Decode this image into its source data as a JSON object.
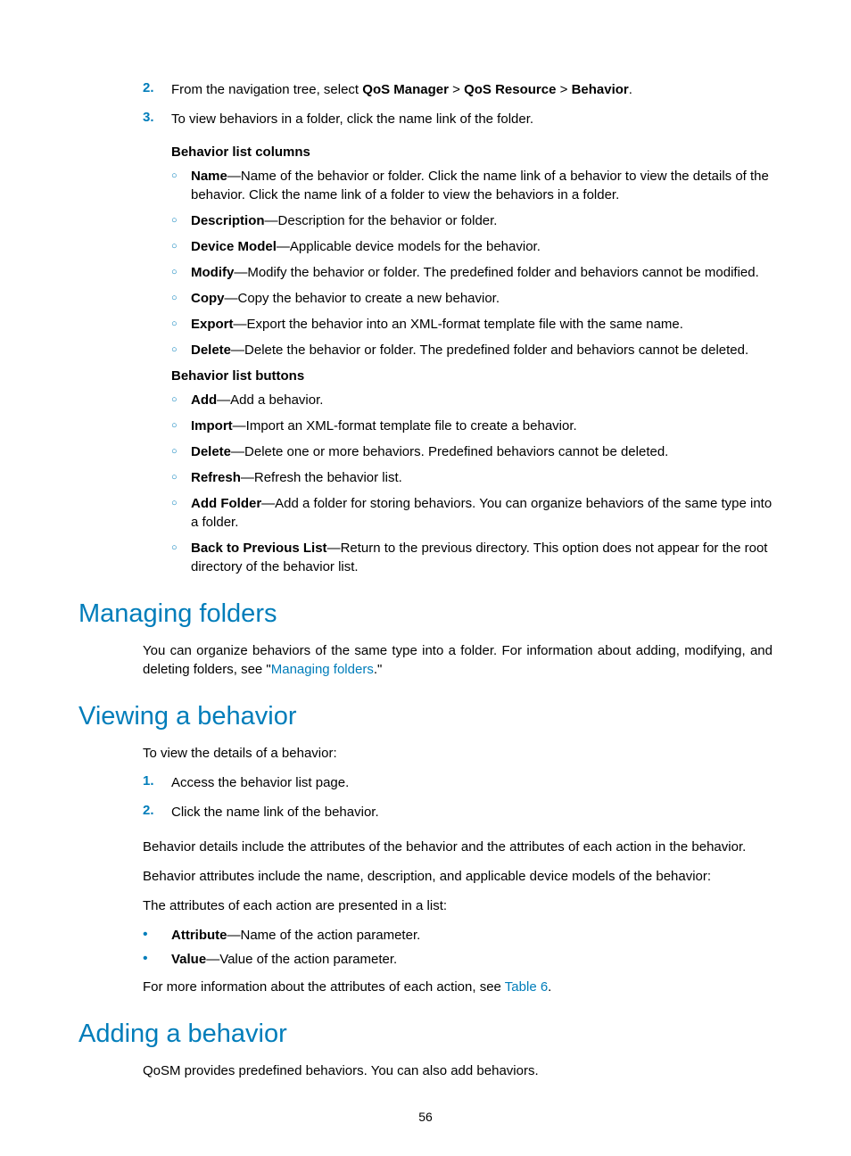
{
  "steps": {
    "s2": {
      "num": "2.",
      "pre": "From the navigation tree, select ",
      "b1": "QoS Manager",
      "sep1": " > ",
      "b2": "QoS Resource",
      "sep2": " > ",
      "b3": "Behavior",
      "post": "."
    },
    "s3": {
      "num": "3.",
      "text": "To view behaviors in a folder, click the name link of the folder."
    }
  },
  "cols_heading": "Behavior list columns",
  "cols": [
    {
      "term": "Name",
      "desc": "—Name of the behavior or folder. Click the name link of a behavior to view the details of the behavior. Click the name link of a folder to view the behaviors in a folder."
    },
    {
      "term": "Description",
      "desc": "—Description for the behavior or folder."
    },
    {
      "term": "Device Model",
      "desc": "—Applicable device models for the behavior."
    },
    {
      "term": "Modify",
      "desc": "—Modify the behavior or folder. The predefined folder and behaviors cannot be modified."
    },
    {
      "term": "Copy",
      "desc": "—Copy the behavior to create a new behavior."
    },
    {
      "term": "Export",
      "desc": "—Export the behavior into an XML-format template file with the same name."
    },
    {
      "term": "Delete",
      "desc": "—Delete the behavior or folder. The predefined folder and behaviors cannot be deleted."
    }
  ],
  "btns_heading": "Behavior list buttons",
  "btns": [
    {
      "term": "Add",
      "desc": "—Add a behavior."
    },
    {
      "term": "Import",
      "desc": "—Import an XML-format template file to create a behavior."
    },
    {
      "term": "Delete",
      "desc": "—Delete one or more behaviors. Predefined behaviors cannot be deleted."
    },
    {
      "term": "Refresh",
      "desc": "—Refresh the behavior list."
    },
    {
      "term": "Add Folder",
      "desc": "—Add a folder for storing behaviors. You can organize behaviors of the same type into a folder."
    },
    {
      "term": "Back to Previous List",
      "desc": "—Return to the previous directory. This option does not appear for the root directory of the behavior list."
    }
  ],
  "managing": {
    "heading": "Managing folders",
    "p_pre": "You can organize behaviors of the same type into a folder. For information about adding, modifying, and deleting folders, see \"",
    "link": "Managing folders",
    "p_post": ".\""
  },
  "viewing": {
    "heading": "Viewing a behavior",
    "intro": "To view the details of a behavior:",
    "s1": {
      "num": "1.",
      "text": "Access the behavior list page."
    },
    "s2": {
      "num": "2.",
      "text": "Click the name link of the behavior."
    },
    "p1": "Behavior details include the attributes of the behavior and the attributes of each action in the behavior.",
    "p2": "Behavior attributes include the name, description, and applicable device models of the behavior:",
    "p3": "The attributes of each action are presented in a list:",
    "attrs": [
      {
        "term": "Attribute",
        "desc": "—Name of the action parameter."
      },
      {
        "term": "Value",
        "desc": "—Value of the action parameter."
      }
    ],
    "more_pre": "For more information about the attributes of each action, see ",
    "more_link": "Table 6",
    "more_post": "."
  },
  "adding": {
    "heading": "Adding a behavior",
    "p1": "QoSM provides predefined behaviors. You can also add behaviors."
  },
  "page_number": "56",
  "marks": {
    "circ": "○",
    "bull": "•"
  }
}
